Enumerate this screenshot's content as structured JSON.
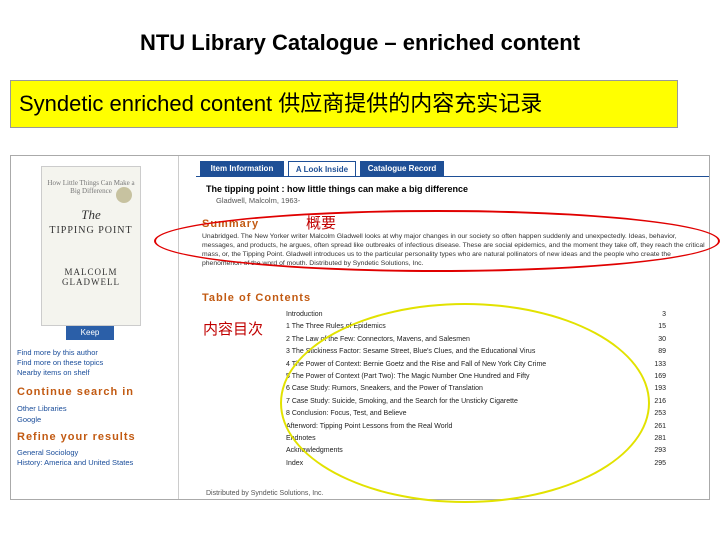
{
  "slide": {
    "title": "NTU Library Catalogue – enriched content",
    "subtitle": "Syndetic enriched content 供应商提供的内容充实记录",
    "label_summary_cn": "概要",
    "label_toc_cn": "内容目次"
  },
  "left_panel": {
    "cover": {
      "tagline": "How Little Things Can Make a Big Difference",
      "title_the": "The",
      "title_main": "TIPPING POINT",
      "author": "MALCOLM GLADWELL"
    },
    "keep_label": "Keep",
    "links_top": [
      "Find more by this author",
      "Find more on these topics",
      "Nearby items on shelf"
    ],
    "continue_heading": "Continue search in",
    "continue_links": [
      "Other Libraries",
      "Google"
    ],
    "refine_heading": "Refine your results",
    "refine_links": [
      "General Sociology",
      "History: America and United States"
    ]
  },
  "right_panel": {
    "tabs": [
      "Item Information",
      "A Look Inside",
      "Catalogue Record"
    ],
    "book_title": "The tipping point : how little things can make a big difference",
    "book_author": "Gladwell, Malcolm, 1963-",
    "summary_heading": "Summary",
    "summary_text": "Unabridged. The New Yorker writer Malcolm Gladwell looks at why major changes in our society so often happen suddenly and unexpectedly. Ideas, behavior, messages, and products, he argues, often spread like outbreaks of infectious disease. These are social epidemics, and the moment they take off, they reach the critical mass, or, the Tipping Point. Gladwell introduces us to the particular personality types who are natural pollinators of new ideas and the people who create the phenomenon of the word of mouth. Distributed by Syndetic Solutions, Inc.",
    "toc_heading": "Table of Contents",
    "toc": [
      {
        "title": "Introduction",
        "page": "3"
      },
      {
        "title": "1 The Three Rules of Epidemics",
        "page": "15"
      },
      {
        "title": "2 The Law of the Few: Connectors, Mavens, and Salesmen",
        "page": "30"
      },
      {
        "title": "3 The Stickiness Factor: Sesame Street, Blue's Clues, and the Educational Virus",
        "page": "89"
      },
      {
        "title": "4 The Power of Context: Bernie Goetz and the Rise and Fall of New York City Crime",
        "page": "133"
      },
      {
        "title": "5 The Power of Context (Part Two): The Magic Number One Hundred and Fifty",
        "page": "169"
      },
      {
        "title": "6 Case Study: Rumors, Sneakers, and the Power of Translation",
        "page": "193"
      },
      {
        "title": "7 Case Study: Suicide, Smoking, and the Search for the Unsticky Cigarette",
        "page": "216"
      },
      {
        "title": "8 Conclusion: Focus, Test, and Believe",
        "page": "253"
      },
      {
        "title": "Afterword: Tipping Point Lessons from the Real World",
        "page": "261"
      },
      {
        "title": "Endnotes",
        "page": "281"
      },
      {
        "title": "Acknowledgments",
        "page": "293"
      },
      {
        "title": "Index",
        "page": "295"
      }
    ],
    "distributed_by": "Distributed by Syndetic Solutions, Inc."
  },
  "colors": {
    "highlight": "#ffff00",
    "tab_blue": "#1e4f96",
    "heading_orange": "#c25a12",
    "annotation_red": "#e00000",
    "annotation_yellow": "#e2e200"
  }
}
